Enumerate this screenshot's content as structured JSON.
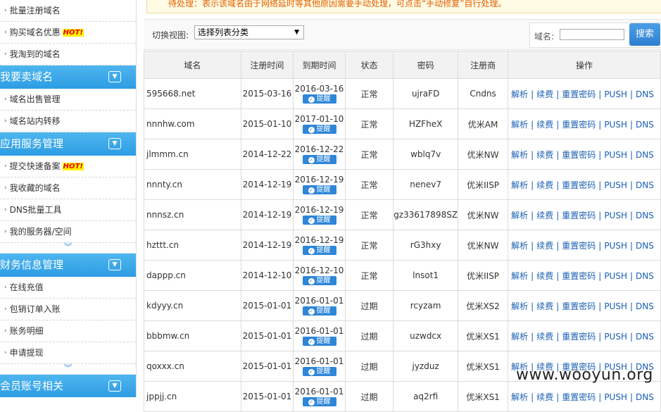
{
  "sidebar": {
    "group1_items": [
      {
        "label": "批量注册域名",
        "hot": false
      },
      {
        "label": "购买域名优惠",
        "hot": true
      },
      {
        "label": "我淘到的域名",
        "hot": false
      }
    ],
    "group2_title": "我要卖域名",
    "group2_items": [
      {
        "label": "域名出售管理"
      },
      {
        "label": "域名站内转移"
      }
    ],
    "group3_title": "应用服务管理",
    "group3_items": [
      {
        "label": "提交快速备案",
        "hot": true
      },
      {
        "label": "我收藏的域名",
        "hot": false
      },
      {
        "label": "DNS批量工具",
        "hot": false
      },
      {
        "label": "我的服务器/空间",
        "hot": false
      }
    ],
    "group4_title": "财务信息管理",
    "group4_items": [
      {
        "label": "在线充值"
      },
      {
        "label": "包销订单入账"
      },
      {
        "label": "账务明细"
      },
      {
        "label": "申请提现"
      }
    ],
    "group5_title": "会员账号相关",
    "hot_label": "HOT!",
    "more_glyph": "︾"
  },
  "notice": {
    "text": "待处理：表示该域名由于网络延时等其他原因需要手动处理，可点击“手动修复”自行处理。"
  },
  "toolbar": {
    "view_label": "切换视图:",
    "view_select_value": "选择列表分类",
    "search_label": "域名:",
    "search_value": "",
    "search_button": "搜索"
  },
  "table": {
    "headers": [
      "域名",
      "注册时间",
      "到期时间",
      "状态",
      "密码",
      "注册商",
      "操作"
    ],
    "remind_label": "提醒",
    "ops": [
      "解析",
      "续费",
      "重置密码",
      "PUSH",
      "DNS"
    ],
    "rows": [
      {
        "domain": "595668.net",
        "reg": "2015-03-16",
        "exp": "2016-03-16",
        "status": "正常",
        "expired": false,
        "pwd": "ujraFD",
        "registrar": "Cndns"
      },
      {
        "domain": "nnnhw.com",
        "reg": "2015-01-10",
        "exp": "2017-01-10",
        "status": "正常",
        "expired": false,
        "pwd": "HZFheX",
        "registrar": "优米AM"
      },
      {
        "domain": "jlmmm.cn",
        "reg": "2014-12-22",
        "exp": "2016-12-22",
        "status": "正常",
        "expired": false,
        "pwd": "wblq7v",
        "registrar": "优米NW"
      },
      {
        "domain": "nnnty.cn",
        "reg": "2014-12-19",
        "exp": "2016-12-19",
        "status": "正常",
        "expired": false,
        "pwd": "nenev7",
        "registrar": "优米IISP"
      },
      {
        "domain": "nnnsz.cn",
        "reg": "2014-12-19",
        "exp": "2016-12-19",
        "status": "正常",
        "expired": false,
        "pwd": "gz33617898SZ",
        "registrar": "优米NW"
      },
      {
        "domain": "hzttt.cn",
        "reg": "2014-12-19",
        "exp": "2016-12-19",
        "status": "正常",
        "expired": false,
        "pwd": "rG3hxy",
        "registrar": "优米NW"
      },
      {
        "domain": "dappp.cn",
        "reg": "2014-12-10",
        "exp": "2016-12-10",
        "status": "正常",
        "expired": false,
        "pwd": "lnsot1",
        "registrar": "优米IISP"
      },
      {
        "domain": "kdyyy.cn",
        "reg": "2015-01-01",
        "exp": "2016-01-01",
        "status": "过期",
        "expired": true,
        "pwd": "rcyzam",
        "registrar": "优米XS2"
      },
      {
        "domain": "bbbmw.cn",
        "reg": "2015-01-01",
        "exp": "2016-01-01",
        "status": "过期",
        "expired": true,
        "pwd": "uzwdcx",
        "registrar": "优米XS1"
      },
      {
        "domain": "qoxxx.cn",
        "reg": "2015-01-01",
        "exp": "2016-01-01",
        "status": "过期",
        "expired": true,
        "pwd": "jyzduz",
        "registrar": "优米XS1"
      },
      {
        "domain": "jppjj.cn",
        "reg": "2015-01-01",
        "exp": "2016-01-01",
        "status": "过期",
        "expired": true,
        "pwd": "aq2rfi",
        "registrar": "优米XS1"
      }
    ]
  },
  "watermark": "www.wooyun.org",
  "colors": {
    "accent": "#2d9ce3",
    "expired": "#ee0000",
    "link": "#1a5fb4"
  }
}
